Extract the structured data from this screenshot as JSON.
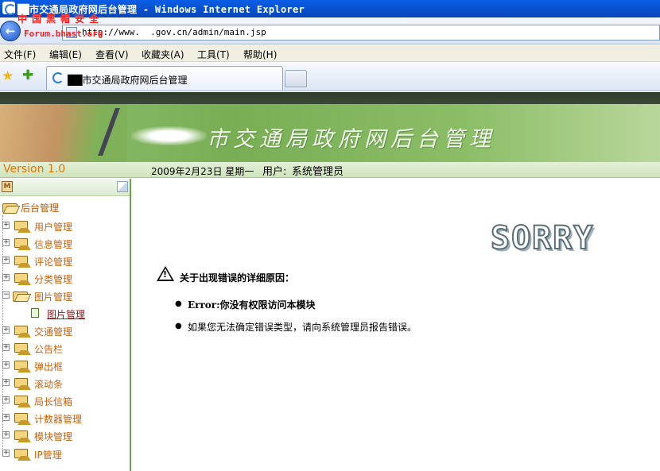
{
  "browser": {
    "window_title": "██市交通局政府网后台管理 - Windows Internet Explorer",
    "watermark_line1": "中国黑帽安全",
    "watermark_line2": "Forum.bhast.org",
    "address_url": "http://www.  .gov.cn/admin/main.jsp",
    "menu": [
      "文件(F)",
      "编辑(E)",
      "查看(V)",
      "收藏夹(A)",
      "工具(T)",
      "帮助(H)"
    ],
    "tab_title": "██市交通局政府网后台管理"
  },
  "site": {
    "banner_title": "市交通局政府网后台管理",
    "version": "Version 1.0",
    "date": "2009年2月23日  星期一",
    "user_label": "用户:",
    "user_value": "系统管理员"
  },
  "sidebar": {
    "root": "后台管理",
    "items": [
      {
        "label": "用户管理"
      },
      {
        "label": "信息管理"
      },
      {
        "label": "评论管理"
      },
      {
        "label": "分类管理"
      },
      {
        "label": "图片管理"
      },
      {
        "label": "图片管理"
      },
      {
        "label": "交通管理"
      },
      {
        "label": "公告栏"
      },
      {
        "label": "弹出框"
      },
      {
        "label": "滚动条"
      },
      {
        "label": "局长信箱"
      },
      {
        "label": "计数器管理"
      },
      {
        "label": "模块管理"
      },
      {
        "label": "IP管理"
      }
    ]
  },
  "error": {
    "sorry_text": "SORRY",
    "title": "关于出现错误的详细原因：",
    "reason1": "Error:你没有权限访问本模块",
    "reason2": "如果您无法确定错误类型，请向系统管理员报告错误。"
  },
  "colors": {
    "titlebar": "#0a5ee6",
    "banner_green": "#79ae55",
    "menu_text": "#c2620e",
    "version_orange": "#e27400"
  }
}
